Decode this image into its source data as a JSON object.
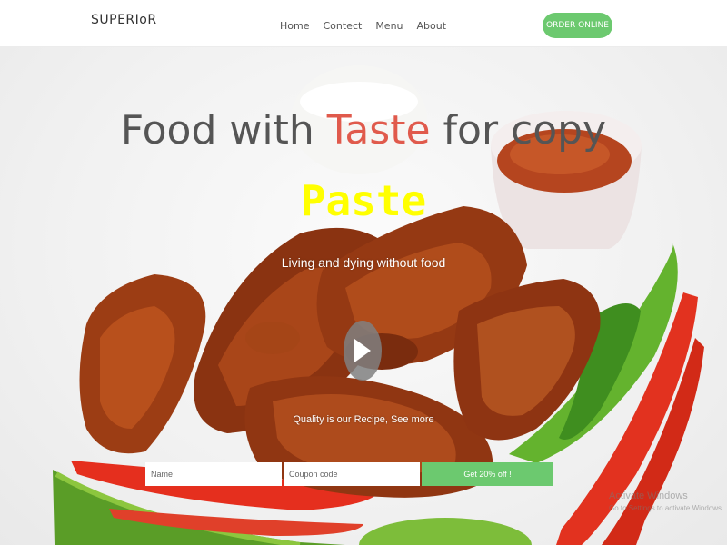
{
  "navbar": {
    "brand": "SUPERIoR",
    "links": [
      "Home",
      "Contect",
      "Menu",
      "About"
    ],
    "order_button": "ORDER ONLINE"
  },
  "hero": {
    "headline_part1": "Food with ",
    "headline_accent": "Taste",
    "headline_part2": " for copy",
    "headline_line2": "Paste",
    "subtitle": "Living and dying without food",
    "tagline": "Quality is our Recipe, See more",
    "play_icon": "play-icon"
  },
  "form": {
    "name_placeholder": "Name",
    "coupon_placeholder": "Coupon code",
    "submit_label": "Get 20% off !"
  },
  "watermark": {
    "line1": "Activate Windows",
    "line2": "Go to Settings to activate Windows."
  },
  "colors": {
    "accent_green": "#6cc96f",
    "headline_accent": "#e05a4c",
    "highlight_yellow": "#ffff00"
  }
}
